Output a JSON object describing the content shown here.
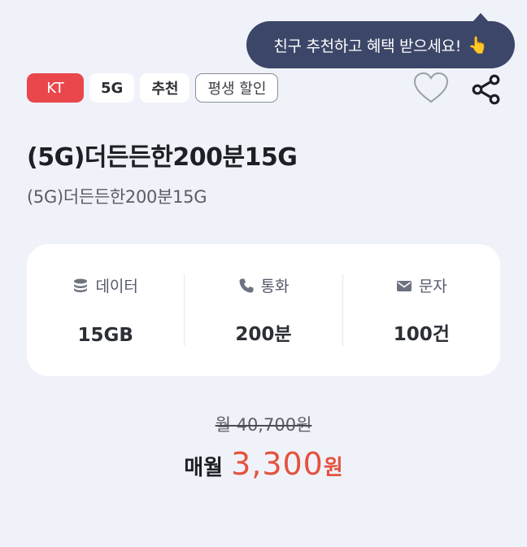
{
  "tooltip": {
    "text": "친구 추천하고 혜택 받으세요!",
    "icon": "pointing-hand-icon"
  },
  "tags": [
    "KT",
    "5G",
    "추천",
    "평생 할인"
  ],
  "actions": {
    "favorite_icon": "heart-icon",
    "share_icon": "share-icon"
  },
  "plan": {
    "title": "(5G)더든든한200분15G",
    "subtitle": "(5G)더든든한200분15G"
  },
  "specs": [
    {
      "label": "데이터",
      "value": "15GB",
      "icon": "database-icon"
    },
    {
      "label": "통화",
      "value": "200분",
      "icon": "phone-icon"
    },
    {
      "label": "문자",
      "value": "100건",
      "icon": "mail-icon"
    }
  ],
  "price": {
    "original": "월 40,700원",
    "label": "매월",
    "amount": "3,300",
    "unit": "원"
  },
  "colors": {
    "accent": "#e4533e",
    "tag_kt": "#e9474c",
    "tooltip_bg": "#3c4668",
    "background": "#f0f2f9"
  }
}
